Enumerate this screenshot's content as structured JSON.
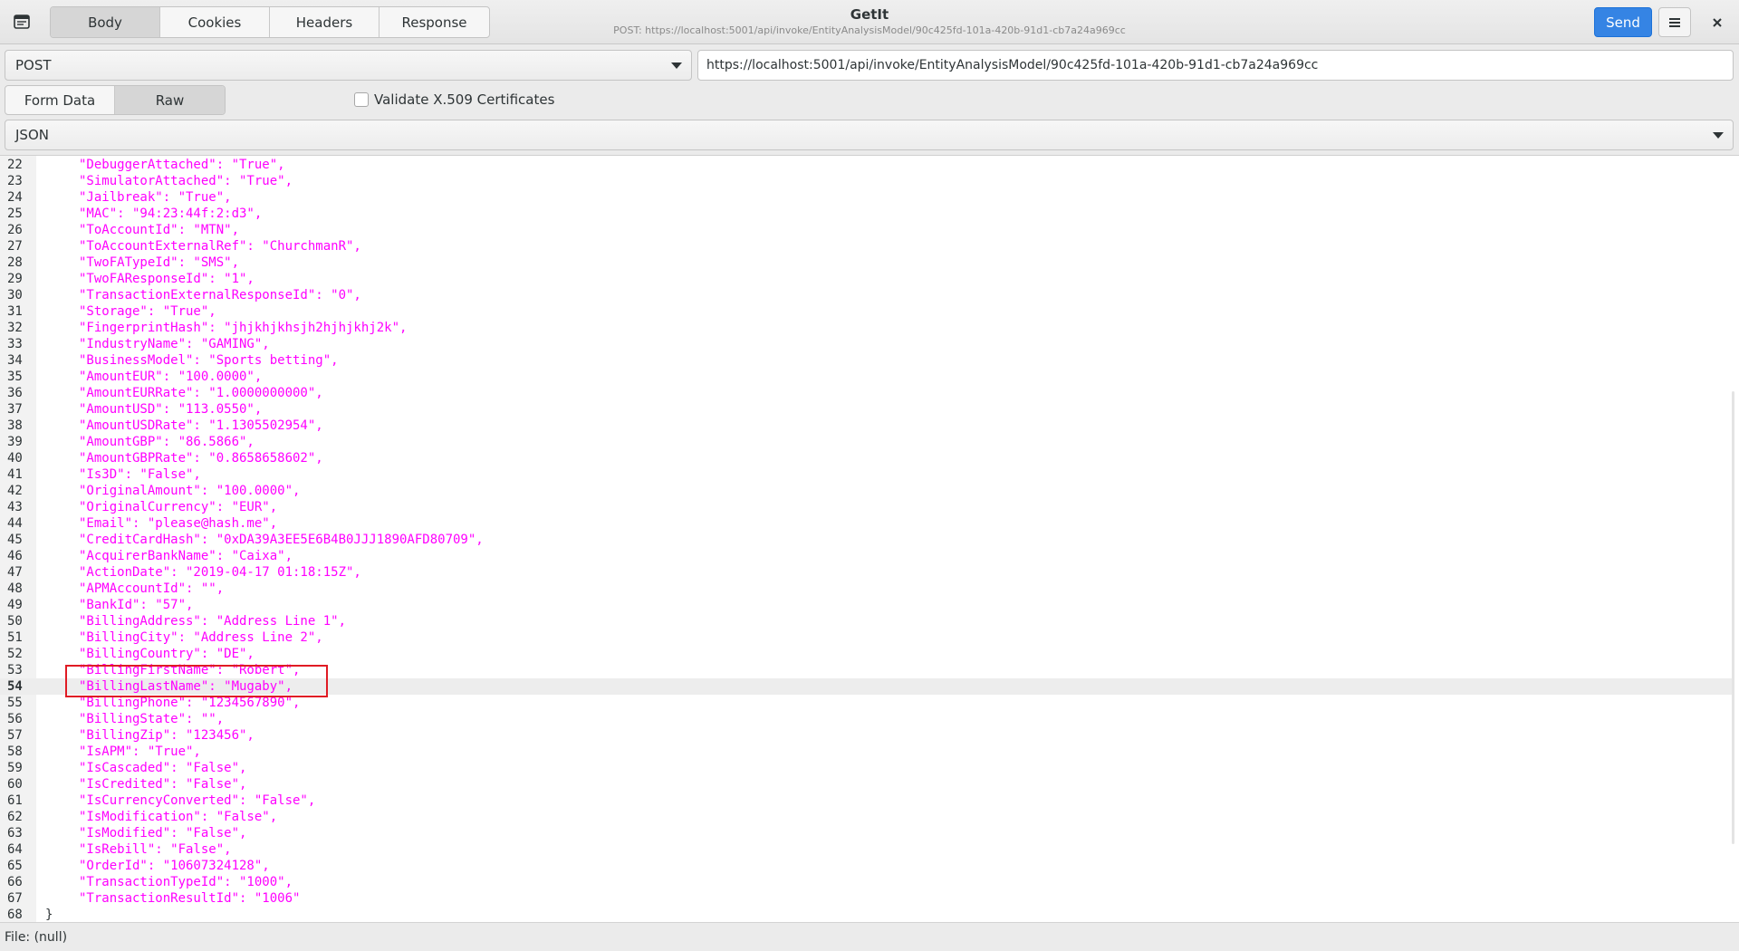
{
  "header": {
    "tabs": [
      "Body",
      "Cookies",
      "Headers",
      "Response"
    ],
    "active_tab": 0,
    "title": "GetIt",
    "subtitle": "POST: https://localhost:5001/api/invoke/EntityAnalysisModel/90c425fd-101a-420b-91d1-cb7a24a969cc",
    "send_label": "Send",
    "menu_icon": "hamburger-menu-icon",
    "close_icon": "close-icon",
    "app_icon": "app-window-icon"
  },
  "request": {
    "method": "POST",
    "url": "https://localhost:5001/api/invoke/EntityAnalysisModel/90c425fd-101a-420b-91d1-cb7a24a969cc"
  },
  "body_mode": {
    "tabs": [
      "Form Data",
      "Raw"
    ],
    "active": 1,
    "validate_label": "Validate X.509 Certificates",
    "validate_checked": false
  },
  "format": {
    "selected": "JSON"
  },
  "editor": {
    "current_line": 54,
    "lines": [
      {
        "n": "22",
        "t": "\"DebuggerAttached\": \"True\","
      },
      {
        "n": "23",
        "t": "\"SimulatorAttached\": \"True\","
      },
      {
        "n": "24",
        "t": "\"Jailbreak\": \"True\","
      },
      {
        "n": "25",
        "t": "\"MAC\": \"94:23:44f:2:d3\","
      },
      {
        "n": "26",
        "t": "\"ToAccountId\": \"MTN\","
      },
      {
        "n": "27",
        "t": "\"ToAccountExternalRef\": \"ChurchmanR\","
      },
      {
        "n": "28",
        "t": "\"TwoFATypeId\": \"SMS\","
      },
      {
        "n": "29",
        "t": "\"TwoFAResponseId\": \"1\","
      },
      {
        "n": "30",
        "t": "\"TransactionExternalResponseId\": \"0\","
      },
      {
        "n": "31",
        "t": "\"Storage\": \"True\","
      },
      {
        "n": "32",
        "t": "\"FingerprintHash\": \"jhjkhjkhsjh2hjhjkhj2k\","
      },
      {
        "n": "33",
        "t": "\"IndustryName\": \"GAMING\","
      },
      {
        "n": "34",
        "t": "\"BusinessModel\": \"Sports betting\","
      },
      {
        "n": "35",
        "t": "\"AmountEUR\": \"100.0000\","
      },
      {
        "n": "36",
        "t": "\"AmountEURRate\": \"1.0000000000\","
      },
      {
        "n": "37",
        "t": "\"AmountUSD\": \"113.0550\","
      },
      {
        "n": "38",
        "t": "\"AmountUSDRate\": \"1.1305502954\","
      },
      {
        "n": "39",
        "t": "\"AmountGBP\": \"86.5866\","
      },
      {
        "n": "40",
        "t": "\"AmountGBPRate\": \"0.8658658602\","
      },
      {
        "n": "41",
        "t": "\"Is3D\": \"False\","
      },
      {
        "n": "42",
        "t": "\"OriginalAmount\": \"100.0000\","
      },
      {
        "n": "43",
        "t": "\"OriginalCurrency\": \"EUR\","
      },
      {
        "n": "44",
        "t": "\"Email\": \"please@hash.me\","
      },
      {
        "n": "45",
        "t": "\"CreditCardHash\": \"0xDA39A3EE5E6B4B0JJJ1890AFD80709\","
      },
      {
        "n": "46",
        "t": "\"AcquirerBankName\": \"Caixa\","
      },
      {
        "n": "47",
        "t": "\"ActionDate\": \"2019-04-17 01:18:15Z\","
      },
      {
        "n": "48",
        "t": "\"APMAccountId\": \"\","
      },
      {
        "n": "49",
        "t": "\"BankId\": \"57\","
      },
      {
        "n": "50",
        "t": "\"BillingAddress\": \"Address Line 1\","
      },
      {
        "n": "51",
        "t": "\"BillingCity\": \"Address Line 2\","
      },
      {
        "n": "52",
        "t": "\"BillingCountry\": \"DE\","
      },
      {
        "n": "53",
        "t": "\"BillingFirstName\": \"Robert\","
      },
      {
        "n": "54",
        "t": "\"BillingLastName\": \"Mugaby\","
      },
      {
        "n": "55",
        "t": "\"BillingPhone\": \"1234567890\","
      },
      {
        "n": "56",
        "t": "\"BillingState\": \"\","
      },
      {
        "n": "57",
        "t": "\"BillingZip\": \"123456\","
      },
      {
        "n": "58",
        "t": "\"IsAPM\": \"True\","
      },
      {
        "n": "59",
        "t": "\"IsCascaded\": \"False\","
      },
      {
        "n": "60",
        "t": "\"IsCredited\": \"False\","
      },
      {
        "n": "61",
        "t": "\"IsCurrencyConverted\": \"False\","
      },
      {
        "n": "62",
        "t": "\"IsModification\": \"False\","
      },
      {
        "n": "63",
        "t": "\"IsModified\": \"False\","
      },
      {
        "n": "64",
        "t": "\"IsRebill\": \"False\","
      },
      {
        "n": "65",
        "t": "\"OrderId\": \"10607324128\","
      },
      {
        "n": "66",
        "t": "\"TransactionTypeId\": \"1000\","
      },
      {
        "n": "67",
        "t": "\"TransactionResultId\": \"1006\""
      },
      {
        "n": "68",
        "t": "}"
      }
    ]
  },
  "status": {
    "file_label": "File: (null)"
  },
  "colors": {
    "accent": "#3584e4",
    "json_string": "#ff00ff",
    "highlight_box": "#e01b24"
  }
}
